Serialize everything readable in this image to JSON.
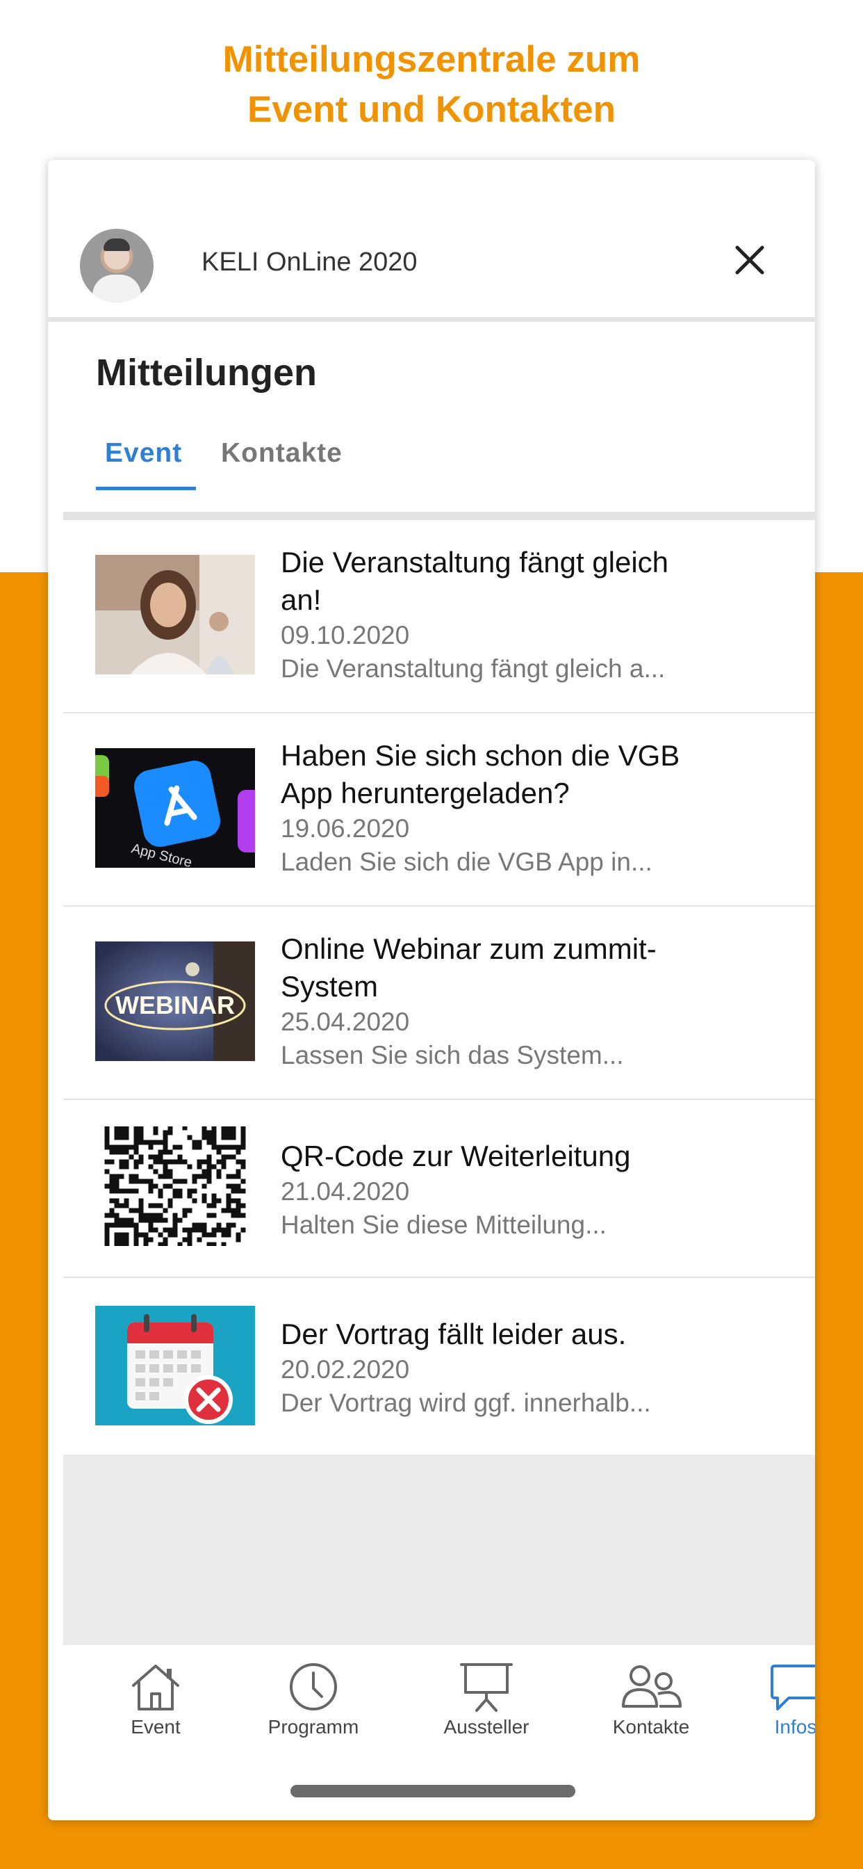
{
  "headline": {
    "line1": "Mitteilungszentrale zum",
    "line2": "Event und Kontakten"
  },
  "header": {
    "event_name": "KELI OnLine 2020"
  },
  "page": {
    "title": "Mitteilungen"
  },
  "tabs": [
    {
      "label": "Event",
      "active": true
    },
    {
      "label": "Kontakte",
      "active": false
    }
  ],
  "messages": [
    {
      "title": "Die Veranstaltung fängt gleich an!",
      "date": "09.10.2020",
      "preview": "Die Veranstaltung fängt gleich a...",
      "thumbnail": "woman-headset-photo"
    },
    {
      "title": "Haben Sie sich schon die VGB App heruntergeladen?",
      "date": "19.06.2020",
      "preview": "Laden Sie sich die VGB App in...",
      "thumbnail": "app-store-photo"
    },
    {
      "title": "Online Webinar zum zummit-System",
      "date": "25.04.2020",
      "preview": "Lassen Sie sich das System...",
      "thumbnail": "webinar-photo",
      "thumbnail_text": "WEBINAR"
    },
    {
      "title": "QR-Code zur Weiterleitung",
      "date": "21.04.2020",
      "preview": "Halten Sie diese Mitteilung...",
      "thumbnail": "qr-code"
    },
    {
      "title": "Der Vortrag fällt leider aus.",
      "date": "20.02.2020",
      "preview": "Der Vortrag wird ggf. innerhalb...",
      "thumbnail": "calendar-cancel-icon"
    }
  ],
  "tabbar": [
    {
      "label": "Event",
      "icon": "home-icon",
      "active": false
    },
    {
      "label": "Programm",
      "icon": "clock-icon",
      "active": false
    },
    {
      "label": "Aussteller",
      "icon": "presentation-icon",
      "active": false
    },
    {
      "label": "Kontakte",
      "icon": "contacts-icon",
      "active": false
    },
    {
      "label": "Infos",
      "icon": "chat-bubble-icon",
      "active": true
    }
  ],
  "colors": {
    "accent_orange": "#F19300",
    "active_blue": "#2F80D5",
    "text_dark": "#111111",
    "text_muted": "#777777"
  }
}
